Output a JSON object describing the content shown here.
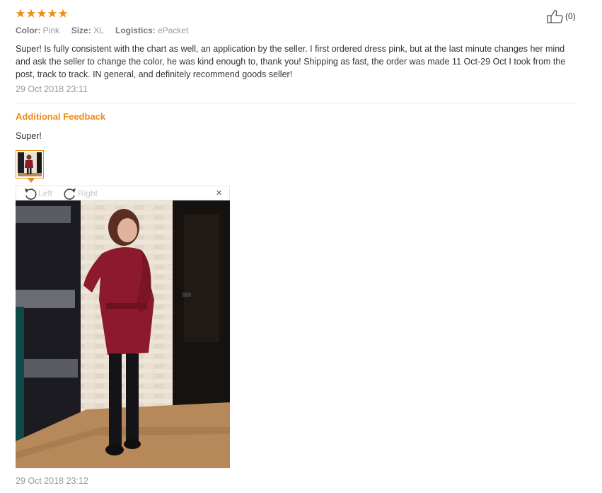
{
  "review": {
    "rating_stars": 5,
    "star_color": "#f28c0f",
    "like_count": "(0)",
    "meta": {
      "color_label": "Color:",
      "color_value": "Pink",
      "size_label": "Size:",
      "size_value": "XL",
      "logistics_label": "Logistics:",
      "logistics_value": "ePacket"
    },
    "text": "Super! Is fully consistent with the chart as well, an application by the seller. I first ordered dress pink, but at the last minute changes her mind and ask the seller to change the color, he was kind enough to, thank you! Shipping as fast, the order was made 11 Oct-29 Oct I took from the post, track to track. IN general, and definitely recommend goods seller!",
    "date": "29 Oct 2018 23:11"
  },
  "additional": {
    "title": "Additional Feedback",
    "text": "Super!",
    "viewer": {
      "rotate_left_label": "Left",
      "rotate_right_label": "Right",
      "close_glyph": "×"
    },
    "date": "29 Oct 2018 23:12"
  }
}
